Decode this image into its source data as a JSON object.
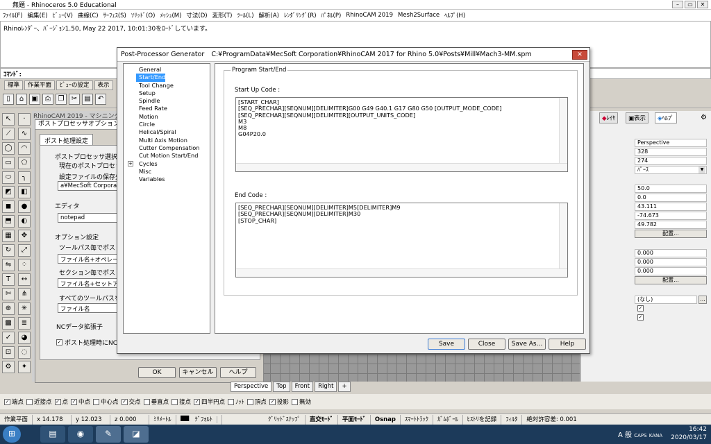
{
  "app": {
    "title": "無題 - Rhinoceros 5.0 Educational",
    "menus": [
      "ﾌｧｲﾙ(F)",
      "編集(E)",
      "ﾋﾞｭｰ(V)",
      "曲線(C)",
      "ｻｰﾌｪｽ(S)",
      "ｿﾘｯﾄﾞ(O)",
      "ﾒｯｼｭ(M)",
      "寸法(D)",
      "変形(T)",
      "ﾂｰﾙ(L)",
      "解析(A)",
      "ﾚﾝﾀﾞﾘﾝｸﾞ(R)",
      "ﾊﾟﾈﾙ(P)",
      "RhinoCAM 2019",
      "Mesh2Surface",
      "ﾍﾙﾌﾟ(H)"
    ],
    "history_line": "Rhinoﾚﾝﾀﾞｰ、ﾊﾞｰｼﾞｮﾝ1.50, May 22 2017, 10:01:30をﾛｰﾄﾞしています。",
    "command_label": "ｺﾏﾝﾄﾞ:"
  },
  "toolbar_tabs": [
    "標準",
    "作業平面",
    "ﾋﾞｭｰの設定",
    "表示"
  ],
  "viewport": {
    "label": "RhinoCAM 2019 - マシニングブ",
    "tabs": [
      "Perspective",
      "Top",
      "Front",
      "Right"
    ],
    "add_tab": "+"
  },
  "post_options": {
    "title": "ポストプロセッサオプション設",
    "tab": "ポスト処理設定",
    "processor_group": "ポストプロセッサ選択",
    "current_processor_label": "現在のポストプロセッサ",
    "settings_file_label": "設定ファイルの保存先",
    "settings_file_value": "a¥MecSoft Corporation¥",
    "editor_group": "エディタ",
    "editor_value": "notepad",
    "options_group": "オプション設定",
    "per_toolpath_label": "ツールパス毎でポスト処",
    "per_toolpath_value": "ファイル名+オペレーシ",
    "per_section_label": "セクション毎でポスト処",
    "per_section_value": "ファイル名+セットアップ",
    "all_toolpaths_label": "すべてのツールパスを",
    "all_toolpaths_value": "ファイル名",
    "nc_ext_label": "NCデータ拡張子",
    "post_check_label": "ポスト処理時にNCデ",
    "ok": "OK",
    "cancel": "キャンセル",
    "help": "ヘルプ"
  },
  "dialog": {
    "title": "Post-Processor Generator",
    "path": "C:¥ProgramData¥MecSoft Corporation¥RhinoCAM 2017 for Rhino 5.0¥Posts¥Mill¥Mach3-MM.spm",
    "close": "✕",
    "tree": [
      "General",
      "Start/End",
      "Tool Change",
      "Setup",
      "Spindle",
      "Feed Rate",
      "Motion",
      "Circle",
      "Helical/Spiral",
      "Multi Axis Motion",
      "Cutter Compensation",
      "Cut Motion Start/End",
      "Cycles",
      "Misc",
      "Variables"
    ],
    "selected_index": 1,
    "section_title": "Program Start/End",
    "startup_label": "Start Up Code :",
    "startup_code": [
      "[START_CHAR]",
      "[SEQ_PRECHAR][SEQNUM][DELIMITER]G00 G49 G40.1 G17 G80 G50 [OUTPUT_MODE_CODE]",
      "[SEQ_PRECHAR][SEQNUM][DELIMITER][OUTPUT_UNITS_CODE]",
      "M3",
      "M8",
      "G04P20.0"
    ],
    "end_label": "End Code :",
    "end_code": [
      "[SEQ_PRECHAR][SEQNUM][DELIMITER]M5[DELIMITER]M9",
      "[SEQ_PRECHAR][SEQNUM][DELIMITER]M30",
      "[STOP_CHAR]"
    ],
    "buttons": {
      "save": "Save",
      "close": "Close",
      "save_as": "Save As...",
      "help": "Help"
    }
  },
  "properties": {
    "tabs": [
      "ﾚｲﾔ",
      "表示",
      "ﾍﾙﾌﾟ"
    ],
    "values": [
      "Perspective",
      "328",
      "274",
      "ﾊﾟｰｽ",
      "50.0",
      "0.0",
      "43.111",
      "-74.673",
      "49.782"
    ],
    "place_button": "配置...",
    "values2": [
      "0.000",
      "0.000",
      "0.000"
    ],
    "place_button2": "配置...",
    "none_value": "(なし)",
    "browse": "..."
  },
  "osnap": {
    "items": [
      {
        "label": "端点",
        "checked": true
      },
      {
        "label": "近接点",
        "checked": false
      },
      {
        "label": "点",
        "checked": true
      },
      {
        "label": "中点",
        "checked": true
      },
      {
        "label": "中心点",
        "checked": false
      },
      {
        "label": "交点",
        "checked": true
      },
      {
        "label": "垂直点",
        "checked": false
      },
      {
        "label": "接点",
        "checked": false
      },
      {
        "label": "四半円点",
        "checked": true
      },
      {
        "label": "ﾉｯﾄ",
        "checked": false
      },
      {
        "label": "頂点",
        "checked": false
      },
      {
        "label": "投影",
        "checked": true
      },
      {
        "label": "無効",
        "checked": false
      }
    ]
  },
  "status": {
    "cplane": "作業平面",
    "x": "x 14.178",
    "y": "y 12.023",
    "z": "z 0.000",
    "unit": "ﾐﾘﾒｰﾄﾙ",
    "layer": "ﾃﾞﾌｫﾙﾄ",
    "grid_snap": "ｸﾞﾘｯﾄﾞｽﾅｯﾌﾟ",
    "ortho": "直交ﾓｰﾄﾞ",
    "planar": "平面ﾓｰﾄﾞ",
    "osnap": "Osnap",
    "smarttrack": "ｽﾏｰﾄﾄﾗｯｸ",
    "gumball": "ｶﾞﾑﾎﾞｰﾙ",
    "history": "ﾋｽﾄﾘを記録",
    "filter": "ﾌｨﾙﾀ",
    "tolerance": "絶対許容差: 0.001"
  },
  "taskbar": {
    "ime": "A 般",
    "caps": "CAPS",
    "kana": "KANA",
    "time": "16:42",
    "date": "2020/03/17"
  }
}
